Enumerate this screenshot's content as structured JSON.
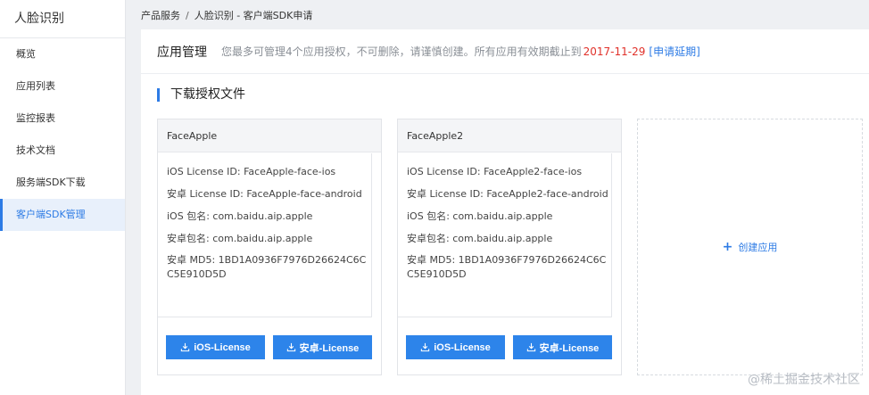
{
  "sidebar": {
    "title": "人脸识别",
    "items": [
      {
        "label": "概览"
      },
      {
        "label": "应用列表"
      },
      {
        "label": "监控报表"
      },
      {
        "label": "技术文档"
      },
      {
        "label": "服务端SDK下载"
      },
      {
        "label": "客户端SDK管理"
      }
    ]
  },
  "breadcrumb": {
    "part1": "产品服务",
    "separator": "/",
    "part2": "人脸识别 - 客户端SDK申请"
  },
  "header": {
    "title": "应用管理",
    "notice": "您最多可管理4个应用授权，不可删除，请谨慎创建。所有应用有效期截止到",
    "expiry_date": "2017-11-29",
    "extend_link": "[申请延期]"
  },
  "section": {
    "title": "下载授权文件"
  },
  "cards": [
    {
      "name": "FaceApple",
      "ios_license": "iOS License ID: FaceApple-face-ios",
      "android_license": "安卓 License ID: FaceApple-face-android",
      "ios_package": "iOS 包名: com.baidu.aip.apple",
      "android_package": "安卓包名: com.baidu.aip.apple",
      "android_md5": "安卓 MD5: 1BD1A0936F7976D26624C6CC5E910D5D",
      "ios_button": "iOS-License",
      "android_button": "安卓-License"
    },
    {
      "name": "FaceApple2",
      "ios_license": "iOS License ID: FaceApple2-face-ios",
      "android_license": "安卓 License ID: FaceApple2-face-android",
      "ios_package": "iOS 包名: com.baidu.aip.apple",
      "android_package": "安卓包名: com.baidu.aip.apple",
      "android_md5": "安卓 MD5: 1BD1A0936F7976D26624C6CC5E910D5D",
      "ios_button": "iOS-License",
      "android_button": "安卓-License"
    }
  ],
  "create_app": {
    "label": "创建应用",
    "plus": "+"
  },
  "watermark": "@稀土掘金技术社区",
  "colors": {
    "accent": "#2d7be5",
    "button": "#2d84ea",
    "date": "#e0312a"
  }
}
